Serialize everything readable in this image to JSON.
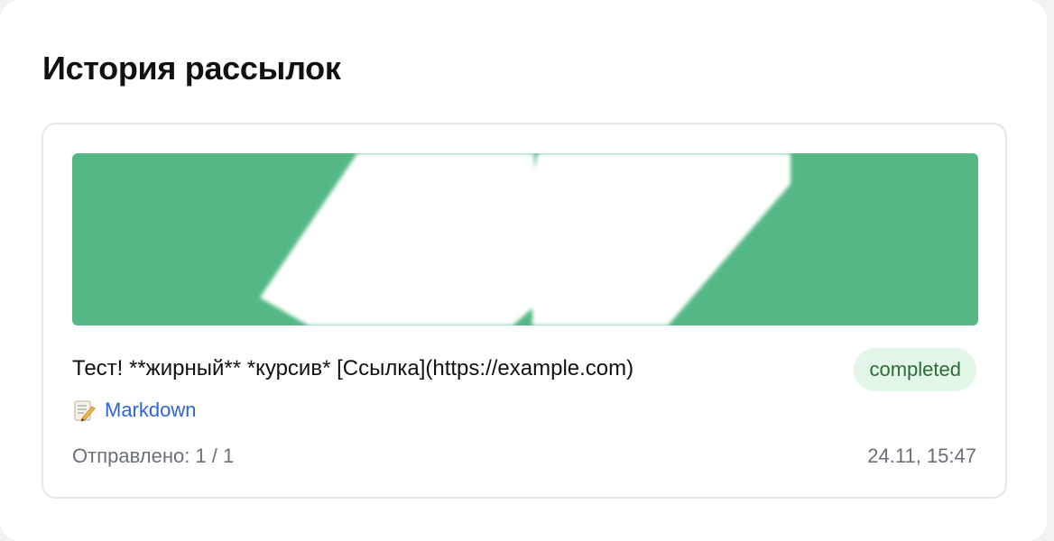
{
  "header": {
    "title": "История рассылок"
  },
  "broadcast": {
    "image": {
      "background_color": "#54b886",
      "shape_color": "#ffffff"
    },
    "message": "Тест! **жирный** *курсив* [Ссылка](https://example.com)",
    "status": "completed",
    "format": {
      "icon": "memo-icon",
      "label": "Markdown"
    },
    "sent_label": "Отправлено: 1 / 1",
    "timestamp": "24.11, 15:47"
  }
}
